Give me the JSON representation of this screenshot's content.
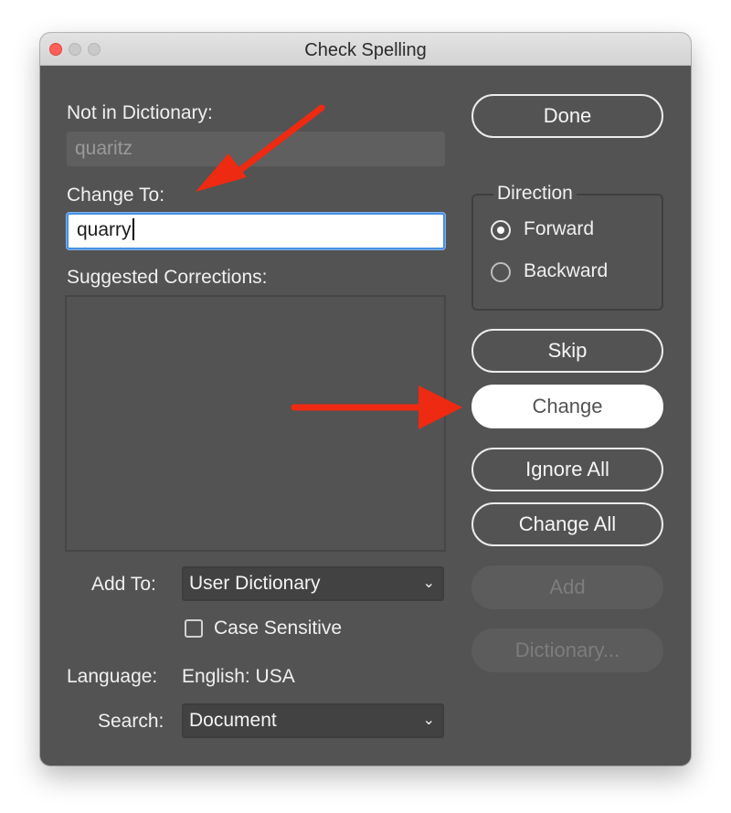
{
  "window": {
    "title": "Check Spelling"
  },
  "not_in_dictionary": {
    "label": "Not in Dictionary:",
    "value": "quaritz"
  },
  "change_to": {
    "label": "Change To:",
    "value": "quarry"
  },
  "suggested_corrections": {
    "label": "Suggested Corrections:",
    "items": []
  },
  "add_to": {
    "label": "Add To:",
    "selected": "User Dictionary"
  },
  "case_sensitive": {
    "label": "Case Sensitive",
    "checked": false
  },
  "language": {
    "label": "Language:",
    "value": "English: USA"
  },
  "search": {
    "label": "Search:",
    "selected": "Document"
  },
  "direction": {
    "label": "Direction",
    "options": [
      {
        "label": "Forward",
        "selected": true
      },
      {
        "label": "Backward",
        "selected": false
      }
    ]
  },
  "buttons": {
    "done": "Done",
    "skip": "Skip",
    "change": "Change",
    "ignore_all": "Ignore All",
    "change_all": "Change All",
    "add": "Add",
    "dictionary": "Dictionary..."
  },
  "colors": {
    "panel": "#535353",
    "annotation_arrow": "#ee2a12",
    "focus_ring": "#4a90e2"
  }
}
